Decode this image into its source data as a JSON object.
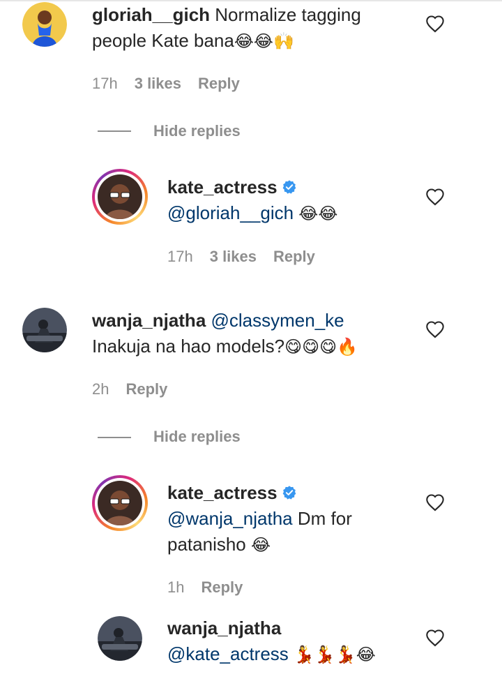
{
  "comments": [
    {
      "username": "gloriah__gich",
      "line1": "Normalize tagging",
      "line2": "people Kate bana",
      "emojis": "😂😂🙌",
      "time": "17h",
      "likes": "3 likes",
      "reply": "Reply"
    },
    {
      "username": "kate_actress",
      "mention": "@gloriah__gich",
      "emojis": "😂😂",
      "time": "17h",
      "likes": "3 likes",
      "reply": "Reply"
    },
    {
      "username": "wanja_njatha",
      "mention": "@classymen_ke",
      "line2": "Inakuja na hao models?",
      "emojis": "😋😋😋🔥",
      "time": "2h",
      "reply": "Reply"
    },
    {
      "username": "kate_actress",
      "mention": "@wanja_njatha",
      "text": "Dm for",
      "line2": "patanisho",
      "emojis": "😂",
      "time": "1h",
      "reply": "Reply"
    },
    {
      "username": "wanja_njatha",
      "mention": "@kate_actress",
      "emojis": "💃💃💃😂"
    }
  ],
  "hide_replies_label": "Hide replies",
  "colors": {
    "mention": "#00376b",
    "meta": "#8e8e8e",
    "verified": "#3897f0"
  },
  "icons": {
    "like": "heart-outline-icon",
    "verified": "verified-badge-icon"
  }
}
